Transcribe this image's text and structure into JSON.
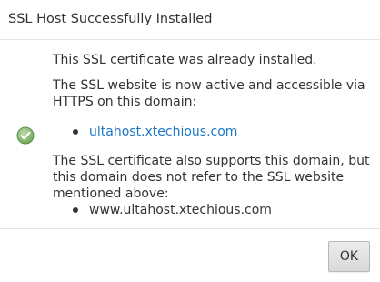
{
  "dialog": {
    "title": "SSL Host Successfully Installed"
  },
  "body": {
    "status_icon": "check-circle-icon",
    "already_installed_text": "This SSL certificate was already installed.",
    "active_text": "The SSL website is now active and accessible via HTTPS on this domain:",
    "primary_domains": [
      "ultahost.xtechious.com"
    ],
    "also_supports_text": "The SSL certificate also supports this domain, but this domain does not refer to the SSL website mentioned above:",
    "secondary_domains": [
      "www.ultahost.xtechious.com"
    ]
  },
  "footer": {
    "ok_label": "OK"
  },
  "colors": {
    "link": "#1e77c5",
    "success": "#7fb36a",
    "text": "#333333"
  }
}
